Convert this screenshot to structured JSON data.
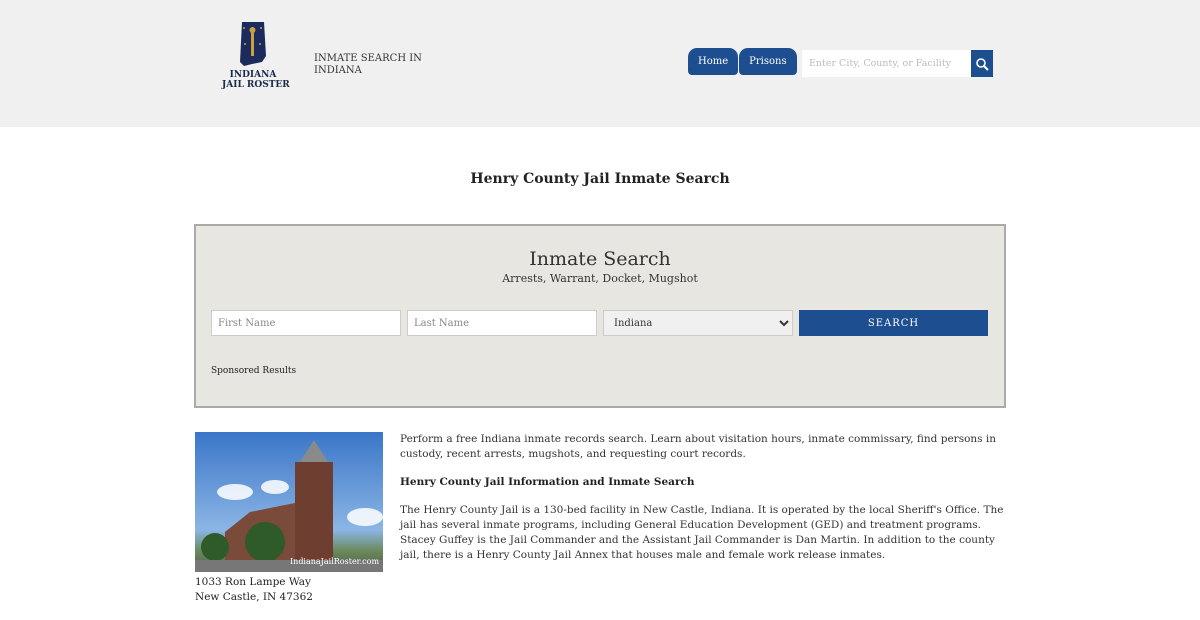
{
  "header": {
    "logo_text_line1": "INDIANA",
    "logo_text_line2": "JAIL ROSTER",
    "tagline": "INMATE SEARCH IN INDIANA",
    "nav": [
      {
        "label": "Home"
      },
      {
        "label": "Prisons"
      }
    ],
    "search_placeholder": "Enter City, County, or Facility"
  },
  "page_title": "Henry County Jail Inmate Search",
  "search_box": {
    "title": "Inmate Search",
    "subtitle": "Arrests, Warrant, Docket, Mugshot",
    "first_name_placeholder": "First Name",
    "last_name_placeholder": "Last Name",
    "state_selected": "Indiana",
    "search_label": "SEARCH",
    "sponsored": "Sponsored Results"
  },
  "facility": {
    "image_watermark": "IndianaJailRoster.com",
    "address_line1": "1033 Ron Lampe Way",
    "address_line2": "New Castle, IN 47362"
  },
  "content": {
    "intro": "Perform a free Indiana inmate records search. Learn about visitation hours, inmate commissary, find persons in custody, recent arrests, mugshots, and requesting court records.",
    "heading": "Henry County Jail Information and Inmate Search",
    "body": "The Henry County Jail is a 130-bed facility in New Castle, Indiana. It is operated by the local Sheriff's Office. The jail has several inmate programs, including General Education Development (GED) and treatment programs. Stacey Guffey is the Jail Commander and the Assistant Jail Commander is Dan Martin. In addition to the county jail, there is a Henry County Jail Annex that houses male and female work release inmates."
  }
}
